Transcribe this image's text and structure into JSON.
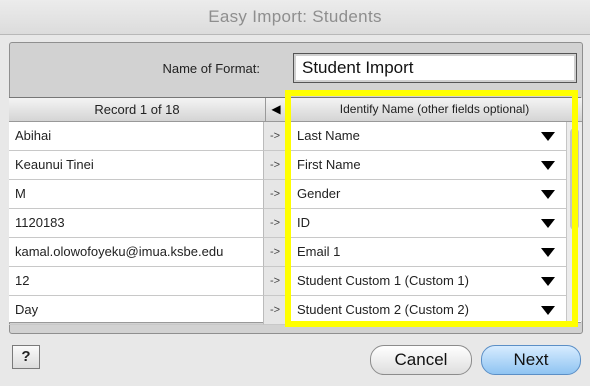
{
  "window": {
    "title": "Easy Import: Students"
  },
  "format": {
    "label": "Name of Format:",
    "value": "Student Import"
  },
  "header": {
    "record_label": "Record 1 of 18",
    "prev_icon": "left-triangle-icon",
    "field_header": "Identify Name (other fields optional)"
  },
  "rows": [
    {
      "value": "Abihai",
      "arrow": "->",
      "field": "Last Name"
    },
    {
      "value": "Keaunui Tinei",
      "arrow": "->",
      "field": "First Name"
    },
    {
      "value": "M",
      "arrow": "->",
      "field": "Gender"
    },
    {
      "value": "1120183",
      "arrow": "->",
      "field": "ID"
    },
    {
      "value": "kamal.olowofoyeku@imua.ksbe.edu",
      "arrow": "->",
      "field": "Email 1"
    },
    {
      "value": "12",
      "arrow": "->",
      "field": "Student Custom 1 (Custom 1)"
    },
    {
      "value": "Day",
      "arrow": "->",
      "field": "Student Custom 2 (Custom 2)"
    }
  ],
  "buttons": {
    "help": "?",
    "cancel": "Cancel",
    "next": "Next"
  },
  "colors": {
    "highlight": "#ffff00",
    "default_button": "#8fc4f2"
  }
}
